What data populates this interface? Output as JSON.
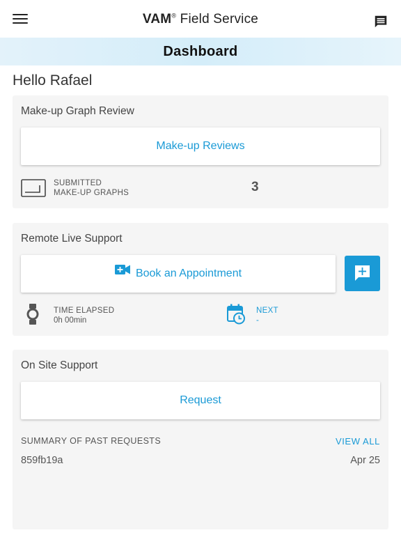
{
  "app": {
    "title_brand": "VAM",
    "title_reg": "®",
    "title_rest": " Field Service"
  },
  "header": {
    "title": "Dashboard"
  },
  "greeting": "Hello Rafael",
  "makeup_card": {
    "title": "Make-up Graph Review",
    "button_label": "Make-up Reviews",
    "stat_label_line1": "SUBMITTED",
    "stat_label_line2": "MAKE-UP GRAPHS",
    "stat_value": "3"
  },
  "remote_card": {
    "title": "Remote Live Support",
    "button_label": "Book an Appointment",
    "elapsed_label": "TIME ELAPSED",
    "elapsed_value": "0h 00min",
    "next_label": "NEXT",
    "next_value": "-"
  },
  "onsite_card": {
    "title": "On Site Support",
    "button_label": "Request",
    "summary_label": "SUMMARY OF PAST REQUESTS",
    "view_all_label": "VIEW ALL",
    "requests": [
      {
        "id": "859fb19a",
        "date": "Apr 25"
      }
    ]
  },
  "colors": {
    "accent": "#1a9ad6",
    "card_bg": "#f5f5f5",
    "header_band": "#d4edf9"
  },
  "icons": {
    "menu": "hamburger-menu-icon",
    "chat": "chat-icon",
    "graph": "graph-frame-icon",
    "video": "video-add-icon",
    "message_add": "message-add-icon",
    "watch": "watch-icon",
    "calendar": "calendar-clock-icon"
  }
}
